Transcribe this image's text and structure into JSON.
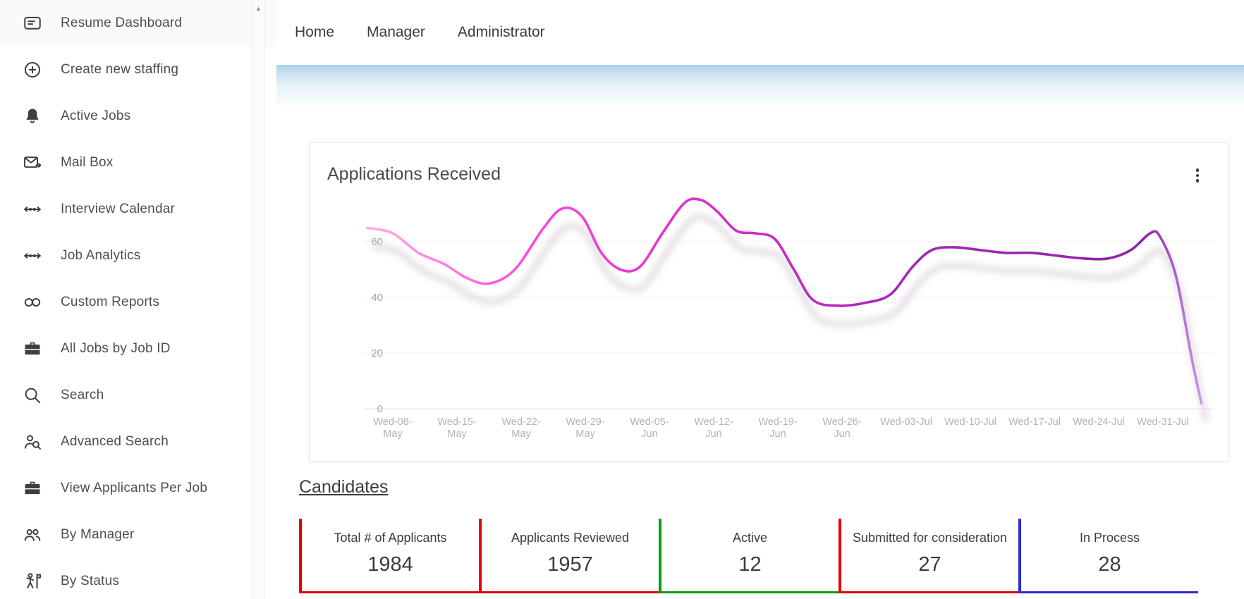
{
  "sidebar": {
    "scroll_up_icon": "chevron-up-icon",
    "items": [
      {
        "label": "Resume Dashboard",
        "icon": "resume-icon"
      },
      {
        "label": "Create new staffing",
        "icon": "plus-circle-icon"
      },
      {
        "label": "Active Jobs",
        "icon": "bell-icon"
      },
      {
        "label": "Mail Box",
        "icon": "mail-icon"
      },
      {
        "label": "Interview Calendar",
        "icon": "timeline-icon"
      },
      {
        "label": "Job Analytics",
        "icon": "timeline-icon"
      },
      {
        "label": "Custom Reports",
        "icon": "link-icon"
      },
      {
        "label": "All Jobs by Job ID",
        "icon": "briefcase-icon"
      },
      {
        "label": "Search",
        "icon": "search-icon"
      },
      {
        "label": "Advanced Search",
        "icon": "person-search-icon"
      },
      {
        "label": "View Applicants Per Job",
        "icon": "briefcase-icon"
      },
      {
        "label": "By Manager",
        "icon": "people-icon"
      },
      {
        "label": "By Status",
        "icon": "person-flag-icon"
      }
    ]
  },
  "topnav": {
    "items": [
      {
        "label": "Home"
      },
      {
        "label": "Manager"
      },
      {
        "label": "Administrator"
      }
    ]
  },
  "chart_card": {
    "title": "Applications Received",
    "menu_icon": "kebab-menu-icon"
  },
  "chart_data": {
    "type": "line",
    "title": "Applications Received",
    "x_labels": [
      "Wed-08-May",
      "Wed-15-May",
      "Wed-22-May",
      "Wed-29-May",
      "Wed-05-Jun",
      "Wed-12-Jun",
      "Wed-19-Jun",
      "Wed-26-Jun",
      "Wed-03-Jul",
      "Wed-10-Jul",
      "Wed-17-Jul",
      "Wed-24-Jul",
      "Wed-31-Jul"
    ],
    "y_ticks": [
      0,
      20,
      40,
      60
    ],
    "ylim": [
      0,
      80
    ],
    "grid": true,
    "legend": false,
    "series": [
      {
        "name": "Applications Received",
        "x": [
          -0.4,
          0,
          0.4,
          0.8,
          1.15,
          1.5,
          1.9,
          2.35,
          2.65,
          2.95,
          3.25,
          3.55,
          3.85,
          4.2,
          4.55,
          4.8,
          5.05,
          5.35,
          5.65,
          5.95,
          6.25,
          6.55,
          6.95,
          7.35,
          7.75,
          8.1,
          8.4,
          8.75,
          9.15,
          9.55,
          9.95,
          10.35,
          10.75,
          11.15,
          11.5,
          11.8,
          11.95,
          12.2,
          12.45,
          12.6
        ],
        "values": [
          65,
          63,
          56,
          52,
          47,
          45,
          50,
          65,
          72,
          69,
          56,
          50,
          51,
          63,
          74,
          75,
          71,
          64,
          63,
          61,
          50,
          39,
          37,
          38,
          41,
          51,
          57,
          58,
          57,
          56,
          56,
          55,
          54,
          54,
          57,
          63,
          62,
          48,
          18,
          2
        ]
      }
    ],
    "line_gradient": [
      {
        "offset": 0,
        "color": "#ffb0e4"
      },
      {
        "offset": 0.2,
        "color": "#fb49d7"
      },
      {
        "offset": 0.42,
        "color": "#d72ccb"
      },
      {
        "offset": 0.62,
        "color": "#a827b8"
      },
      {
        "offset": 0.93,
        "color": "#8e24aa"
      },
      {
        "offset": 1,
        "color": "#c9a2e6"
      }
    ]
  },
  "candidates": {
    "heading": "Candidates",
    "stats": [
      {
        "label": "Total # of Applicants",
        "value": "1984",
        "accent": "#e60000"
      },
      {
        "label": "Applicants Reviewed",
        "value": "1957",
        "accent": "#e60000"
      },
      {
        "label": "Active",
        "value": "12",
        "accent": "#0e9c0e"
      },
      {
        "label": "Submitted for consideration",
        "value": "27",
        "accent": "#e60000"
      },
      {
        "label": "In Process",
        "value": "28",
        "accent": "#2b2bd6"
      }
    ]
  },
  "colors": {
    "band_blue": "#a9cfe8",
    "axis_text": "#b4aca9",
    "grid": "#f1eeee"
  }
}
